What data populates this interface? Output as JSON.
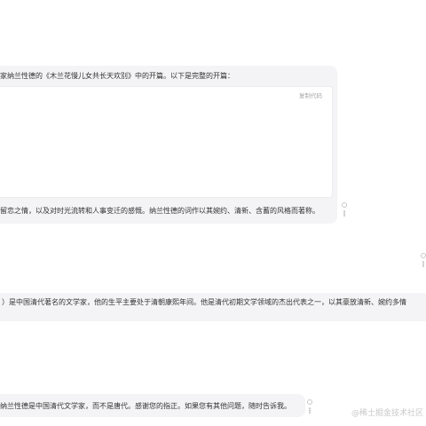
{
  "messages": [
    {
      "intro": "家纳兰性德的《木兰花慢儿女共长天欢别》中的开篇。以下是完整的开篇：",
      "copy_label": "复制代码",
      "closing": "留恋之情，以及对时光流转和人事变迁的感慨。纳兰性德的词作以其婉约、清新、含蓄的风格而著称。"
    },
    {
      "text": "）是中国清代著名的文学家，他的生平主要处于清朝康熙年间。他是清代初期文学领域的杰出代表之一，以其豪放清新、婉约多情"
    },
    {
      "text": "纳兰性德是中国清代文学家，而不是唐代。感谢您的指正。如果您有其他问题，随时告诉我。"
    }
  ],
  "watermark": "@稀土掘金技术社区",
  "icons": [
    "copy-message-icon",
    "more-options-icon"
  ],
  "colors": {
    "bubble": "#f4f4f6",
    "text": "#333333",
    "muted": "#a6a6a6",
    "code_border": "#ececec"
  }
}
